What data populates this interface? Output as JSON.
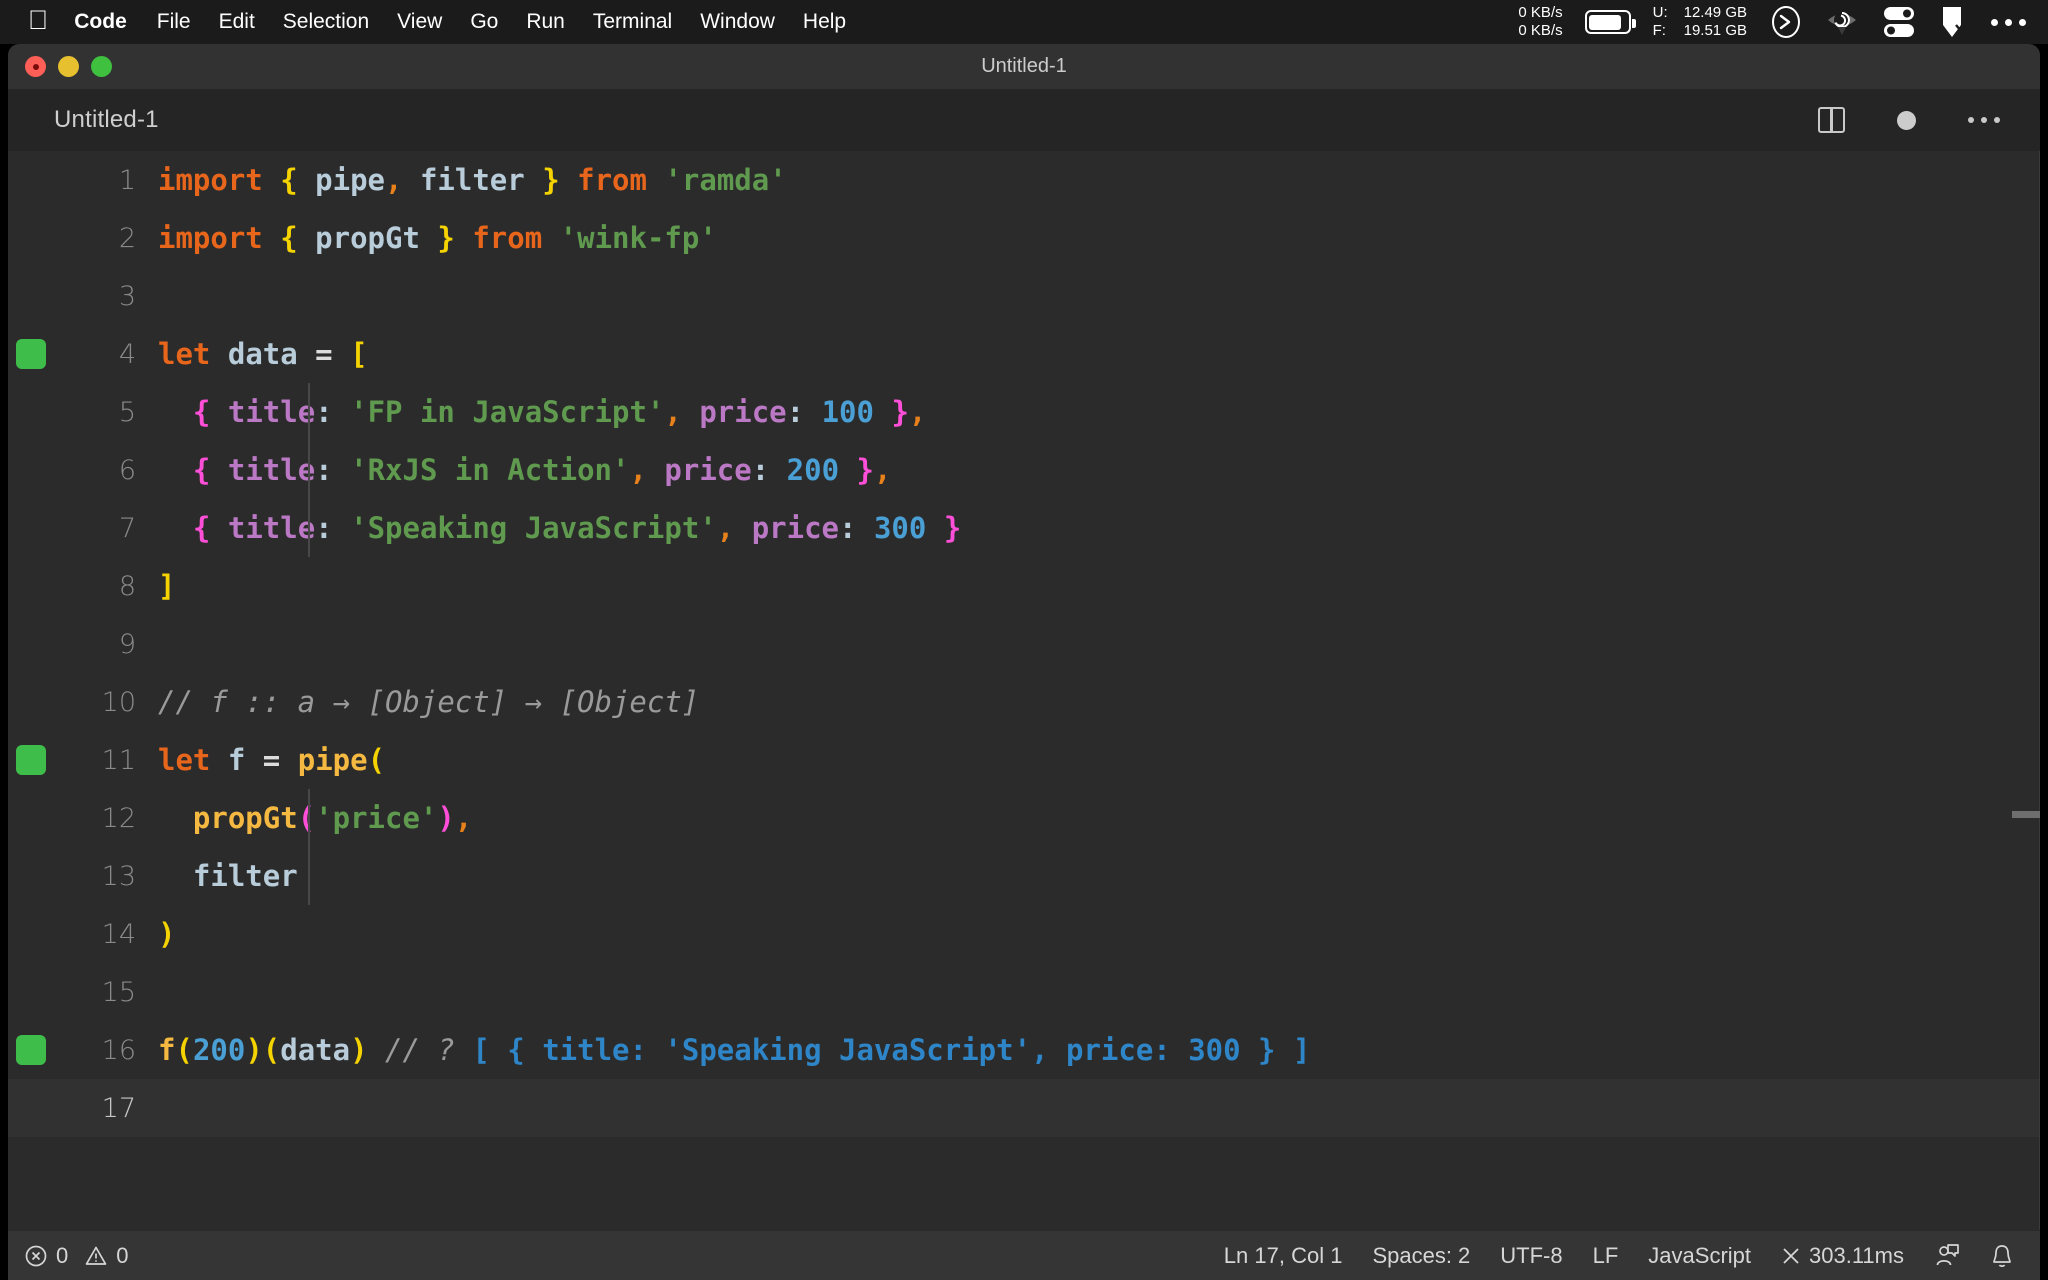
{
  "menubar": {
    "apple_icon": "apple-logo-icon",
    "items": [
      {
        "label": "Code",
        "bold": true
      },
      {
        "label": "File",
        "bold": false
      },
      {
        "label": "Edit",
        "bold": false
      },
      {
        "label": "Selection",
        "bold": false
      },
      {
        "label": "View",
        "bold": false
      },
      {
        "label": "Go",
        "bold": false
      },
      {
        "label": "Run",
        "bold": false
      },
      {
        "label": "Terminal",
        "bold": false
      },
      {
        "label": "Window",
        "bold": false
      },
      {
        "label": "Help",
        "bold": false
      }
    ],
    "status": {
      "net_up": "0 KB/s",
      "net_down": "0 KB/s",
      "battery_icon": "battery-icon",
      "mem_used_label": "U:",
      "mem_used_value": "12.49 GB",
      "mem_free_label": "F:",
      "mem_free_value": "19.51 GB",
      "terminal_icon": "terminal-prompt-icon",
      "eye_icon": "eye-spiral-icon",
      "toggles_icon": "toggle-switches-icon",
      "flag_icon": "flag-icon",
      "more_icon": "ellipsis-icon"
    }
  },
  "window": {
    "title": "Untitled-1",
    "close_label": "close",
    "minimize_label": "minimize",
    "maximize_label": "maximize"
  },
  "tabbar": {
    "tab_label": "Untitled-1",
    "split_editor_icon": "split-editor-icon",
    "unsaved_icon": "unsaved-dot-icon",
    "more_actions_icon": "ellipsis-icon"
  },
  "editor": {
    "language": "javascript",
    "lines": [
      {
        "num": "1",
        "marker": false,
        "indent_guide": false,
        "tokens": [
          {
            "text": "import",
            "cls": "t-kw"
          },
          {
            "text": " ",
            "cls": "t-op"
          },
          {
            "text": "{",
            "cls": "t-brace-y"
          },
          {
            "text": " ",
            "cls": "t-op"
          },
          {
            "text": "pipe",
            "cls": "t-var"
          },
          {
            "text": ",",
            "cls": "t-comma"
          },
          {
            "text": " ",
            "cls": "t-op"
          },
          {
            "text": "filter",
            "cls": "t-var"
          },
          {
            "text": " ",
            "cls": "t-op"
          },
          {
            "text": "}",
            "cls": "t-brace-y"
          },
          {
            "text": " ",
            "cls": "t-op"
          },
          {
            "text": "from",
            "cls": "t-kw"
          },
          {
            "text": " ",
            "cls": "t-op"
          },
          {
            "text": "'ramda'",
            "cls": "t-str"
          }
        ]
      },
      {
        "num": "2",
        "marker": false,
        "indent_guide": false,
        "tokens": [
          {
            "text": "import",
            "cls": "t-kw"
          },
          {
            "text": " ",
            "cls": "t-op"
          },
          {
            "text": "{",
            "cls": "t-brace-y"
          },
          {
            "text": " ",
            "cls": "t-op"
          },
          {
            "text": "propGt",
            "cls": "t-var"
          },
          {
            "text": " ",
            "cls": "t-op"
          },
          {
            "text": "}",
            "cls": "t-brace-y"
          },
          {
            "text": " ",
            "cls": "t-op"
          },
          {
            "text": "from",
            "cls": "t-kw"
          },
          {
            "text": " ",
            "cls": "t-op"
          },
          {
            "text": "'wink-fp'",
            "cls": "t-str"
          }
        ]
      },
      {
        "num": "3",
        "marker": false,
        "indent_guide": false,
        "tokens": []
      },
      {
        "num": "4",
        "marker": true,
        "indent_guide": false,
        "tokens": [
          {
            "text": "let",
            "cls": "t-kw"
          },
          {
            "text": " ",
            "cls": "t-op"
          },
          {
            "text": "data",
            "cls": "t-var"
          },
          {
            "text": " ",
            "cls": "t-op"
          },
          {
            "text": "=",
            "cls": "t-op"
          },
          {
            "text": " ",
            "cls": "t-op"
          },
          {
            "text": "[",
            "cls": "t-brace-y"
          }
        ]
      },
      {
        "num": "5",
        "marker": false,
        "indent_guide": true,
        "tokens": [
          {
            "text": "  ",
            "cls": "t-op"
          },
          {
            "text": "{",
            "cls": "t-brace-p"
          },
          {
            "text": " ",
            "cls": "t-op"
          },
          {
            "text": "title",
            "cls": "t-prop"
          },
          {
            "text": ":",
            "cls": "t-colon"
          },
          {
            "text": " ",
            "cls": "t-op"
          },
          {
            "text": "'FP in JavaScript'",
            "cls": "t-str"
          },
          {
            "text": ",",
            "cls": "t-comma"
          },
          {
            "text": " ",
            "cls": "t-op"
          },
          {
            "text": "price",
            "cls": "t-prop"
          },
          {
            "text": ":",
            "cls": "t-colon"
          },
          {
            "text": " ",
            "cls": "t-op"
          },
          {
            "text": "100",
            "cls": "t-num"
          },
          {
            "text": " ",
            "cls": "t-op"
          },
          {
            "text": "}",
            "cls": "t-brace-p"
          },
          {
            "text": ",",
            "cls": "t-comma"
          }
        ]
      },
      {
        "num": "6",
        "marker": false,
        "indent_guide": true,
        "tokens": [
          {
            "text": "  ",
            "cls": "t-op"
          },
          {
            "text": "{",
            "cls": "t-brace-p"
          },
          {
            "text": " ",
            "cls": "t-op"
          },
          {
            "text": "title",
            "cls": "t-prop"
          },
          {
            "text": ":",
            "cls": "t-colon"
          },
          {
            "text": " ",
            "cls": "t-op"
          },
          {
            "text": "'RxJS in Action'",
            "cls": "t-str"
          },
          {
            "text": ",",
            "cls": "t-comma"
          },
          {
            "text": " ",
            "cls": "t-op"
          },
          {
            "text": "price",
            "cls": "t-prop"
          },
          {
            "text": ":",
            "cls": "t-colon"
          },
          {
            "text": " ",
            "cls": "t-op"
          },
          {
            "text": "200",
            "cls": "t-num"
          },
          {
            "text": " ",
            "cls": "t-op"
          },
          {
            "text": "}",
            "cls": "t-brace-p"
          },
          {
            "text": ",",
            "cls": "t-comma"
          }
        ]
      },
      {
        "num": "7",
        "marker": false,
        "indent_guide": true,
        "tokens": [
          {
            "text": "  ",
            "cls": "t-op"
          },
          {
            "text": "{",
            "cls": "t-brace-p"
          },
          {
            "text": " ",
            "cls": "t-op"
          },
          {
            "text": "title",
            "cls": "t-prop"
          },
          {
            "text": ":",
            "cls": "t-colon"
          },
          {
            "text": " ",
            "cls": "t-op"
          },
          {
            "text": "'Speaking JavaScript'",
            "cls": "t-str"
          },
          {
            "text": ",",
            "cls": "t-comma"
          },
          {
            "text": " ",
            "cls": "t-op"
          },
          {
            "text": "price",
            "cls": "t-prop"
          },
          {
            "text": ":",
            "cls": "t-colon"
          },
          {
            "text": " ",
            "cls": "t-op"
          },
          {
            "text": "300",
            "cls": "t-num"
          },
          {
            "text": " ",
            "cls": "t-op"
          },
          {
            "text": "}",
            "cls": "t-brace-p"
          }
        ]
      },
      {
        "num": "8",
        "marker": false,
        "indent_guide": false,
        "tokens": [
          {
            "text": "]",
            "cls": "t-brace-y"
          }
        ]
      },
      {
        "num": "9",
        "marker": false,
        "indent_guide": false,
        "tokens": []
      },
      {
        "num": "10",
        "marker": false,
        "indent_guide": false,
        "tokens": [
          {
            "text": "// f :: a → [Object] → [Object]",
            "cls": "t-comment"
          }
        ]
      },
      {
        "num": "11",
        "marker": true,
        "indent_guide": false,
        "tokens": [
          {
            "text": "let",
            "cls": "t-kw"
          },
          {
            "text": " ",
            "cls": "t-op"
          },
          {
            "text": "f",
            "cls": "t-var"
          },
          {
            "text": " ",
            "cls": "t-op"
          },
          {
            "text": "=",
            "cls": "t-op"
          },
          {
            "text": " ",
            "cls": "t-op"
          },
          {
            "text": "pipe",
            "cls": "t-fn"
          },
          {
            "text": "(",
            "cls": "t-brace-y"
          }
        ]
      },
      {
        "num": "12",
        "marker": false,
        "indent_guide": true,
        "tokens": [
          {
            "text": "  ",
            "cls": "t-op"
          },
          {
            "text": "propGt",
            "cls": "t-fn"
          },
          {
            "text": "(",
            "cls": "t-brace-p"
          },
          {
            "text": "'price'",
            "cls": "t-str"
          },
          {
            "text": ")",
            "cls": "t-brace-p"
          },
          {
            "text": ",",
            "cls": "t-comma"
          }
        ]
      },
      {
        "num": "13",
        "marker": false,
        "indent_guide": true,
        "tokens": [
          {
            "text": "  ",
            "cls": "t-op"
          },
          {
            "text": "filter",
            "cls": "t-var"
          }
        ]
      },
      {
        "num": "14",
        "marker": false,
        "indent_guide": false,
        "tokens": [
          {
            "text": ")",
            "cls": "t-brace-y"
          }
        ]
      },
      {
        "num": "15",
        "marker": false,
        "indent_guide": false,
        "tokens": []
      },
      {
        "num": "16",
        "marker": true,
        "indent_guide": false,
        "tokens": [
          {
            "text": "f",
            "cls": "t-fn"
          },
          {
            "text": "(",
            "cls": "t-brace-y"
          },
          {
            "text": "200",
            "cls": "t-num"
          },
          {
            "text": ")",
            "cls": "t-brace-y"
          },
          {
            "text": "(",
            "cls": "t-brace-y"
          },
          {
            "text": "data",
            "cls": "t-var"
          },
          {
            "text": ")",
            "cls": "t-brace-y"
          },
          {
            "text": " ",
            "cls": "t-op"
          },
          {
            "text": "// ?",
            "cls": "t-comment"
          },
          {
            "text": " ",
            "cls": "t-op"
          },
          {
            "text": "[ { title: 'Speaking JavaScript', price: 300 } ]",
            "cls": "t-result"
          }
        ]
      },
      {
        "num": "17",
        "marker": false,
        "indent_guide": false,
        "active": true,
        "tokens": []
      }
    ]
  },
  "statusbar": {
    "errors_icon": "error-circle-icon",
    "errors_count": "0",
    "warnings_icon": "warning-triangle-icon",
    "warnings_count": "0",
    "cursor_position": "Ln 17, Col 1",
    "indentation": "Spaces: 2",
    "encoding": "UTF-8",
    "eol": "LF",
    "language_mode": "JavaScript",
    "quokka_icon": "close-x-icon",
    "quokka_time": "303.11ms",
    "feedback_icon": "feedback-person-icon",
    "notifications_icon": "bell-icon"
  },
  "colors": {
    "menubar_bg": "#1b1b1b",
    "titlebar_bg": "#323233",
    "tabbar_bg": "#252526",
    "editor_bg": "#2b2b2b",
    "statusbar_bg": "#353535",
    "coverage_green": "#3fbd4a",
    "keyword_orange": "#e8661c",
    "string_green": "#5f9a4f",
    "number_blue": "#4a9fd4",
    "result_blue": "#2e86c8"
  }
}
